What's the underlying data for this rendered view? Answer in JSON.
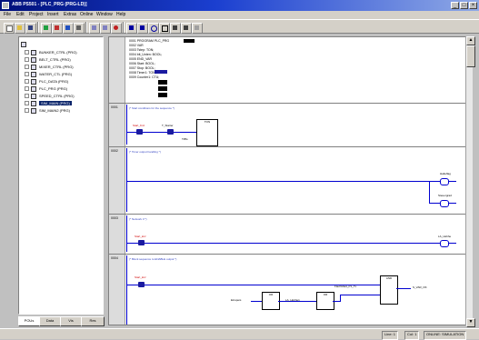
{
  "window": {
    "title": "ABB PS501 - [PLC_PRG (PRG-LD)]"
  },
  "menu": {
    "items": [
      "File",
      "Edit",
      "Project",
      "Insert",
      "Extras",
      "Online",
      "Window",
      "Help"
    ]
  },
  "tree": {
    "items": [
      {
        "label": "BUNKER_CTRL (PRG)",
        "selected": false
      },
      {
        "label": "BELT_CTRL (PRG)",
        "selected": false
      },
      {
        "label": "MIXER_CTRL (PRG)",
        "selected": false
      },
      {
        "label": "WATER_CTL (PRG)",
        "selected": false
      },
      {
        "label": "PLC_DATA (PRG)",
        "selected": false
      },
      {
        "label": "PLC_PRG (PRG)",
        "selected": false
      },
      {
        "label": "SPEED_CTRL (PRG)",
        "selected": false
      },
      {
        "label": "SIM_MAIN (PRG)",
        "selected": true
      },
      {
        "label": "SIM_MAIN2 (PRG)",
        "selected": false
      }
    ]
  },
  "tabs": [
    "POUs",
    "Data",
    "Vis",
    "Res"
  ],
  "editor": {
    "declarations": [
      "0001 PROGRAM PLC_PRG",
      "0002 VAR",
      "0003   Tstep: TON;",
      "0004   bit_Unten: BOOL;",
      "0005 END_VAR",
      "0006   Start: BOOL;",
      "0007   Stop: BOOL;",
      "0008   Timer1: TON;",
      "0009   Counter1: CTU;"
    ],
    "networks": [
      {
        "number": "0001",
        "comment": "(* Start conditions for the sequence *)",
        "contacts": [
          "Start_Knz",
          "T_Starter"
        ],
        "block": "TON",
        "pt_label": "T#5s"
      },
      {
        "number": "0002",
        "comment": "(* Timer output handling *)",
        "coils": [
          "Halteflag",
          "Steuergrad"
        ]
      },
      {
        "number": "0003",
        "comment": "(* Network 3 *)",
        "contacts": [
          "Start_knz"
        ],
        "coils": [
          "LA_Hubhe"
        ]
      },
      {
        "number": "0004",
        "comment": "(* Block sequence to ENABLE output *)",
        "contacts": [
          "Start_knz"
        ],
        "blocks": [
          "OR",
          "OR",
          "AND"
        ],
        "inputs": [
          "Einspeis",
          "LA_Hubhe1",
          "FlachMeld_P1_Tx"
        ],
        "output": "S_VAR_OK"
      }
    ]
  },
  "status": {
    "items": [
      "Line: 1",
      "Col: 1",
      "ONLINE: SIMULATION"
    ]
  }
}
